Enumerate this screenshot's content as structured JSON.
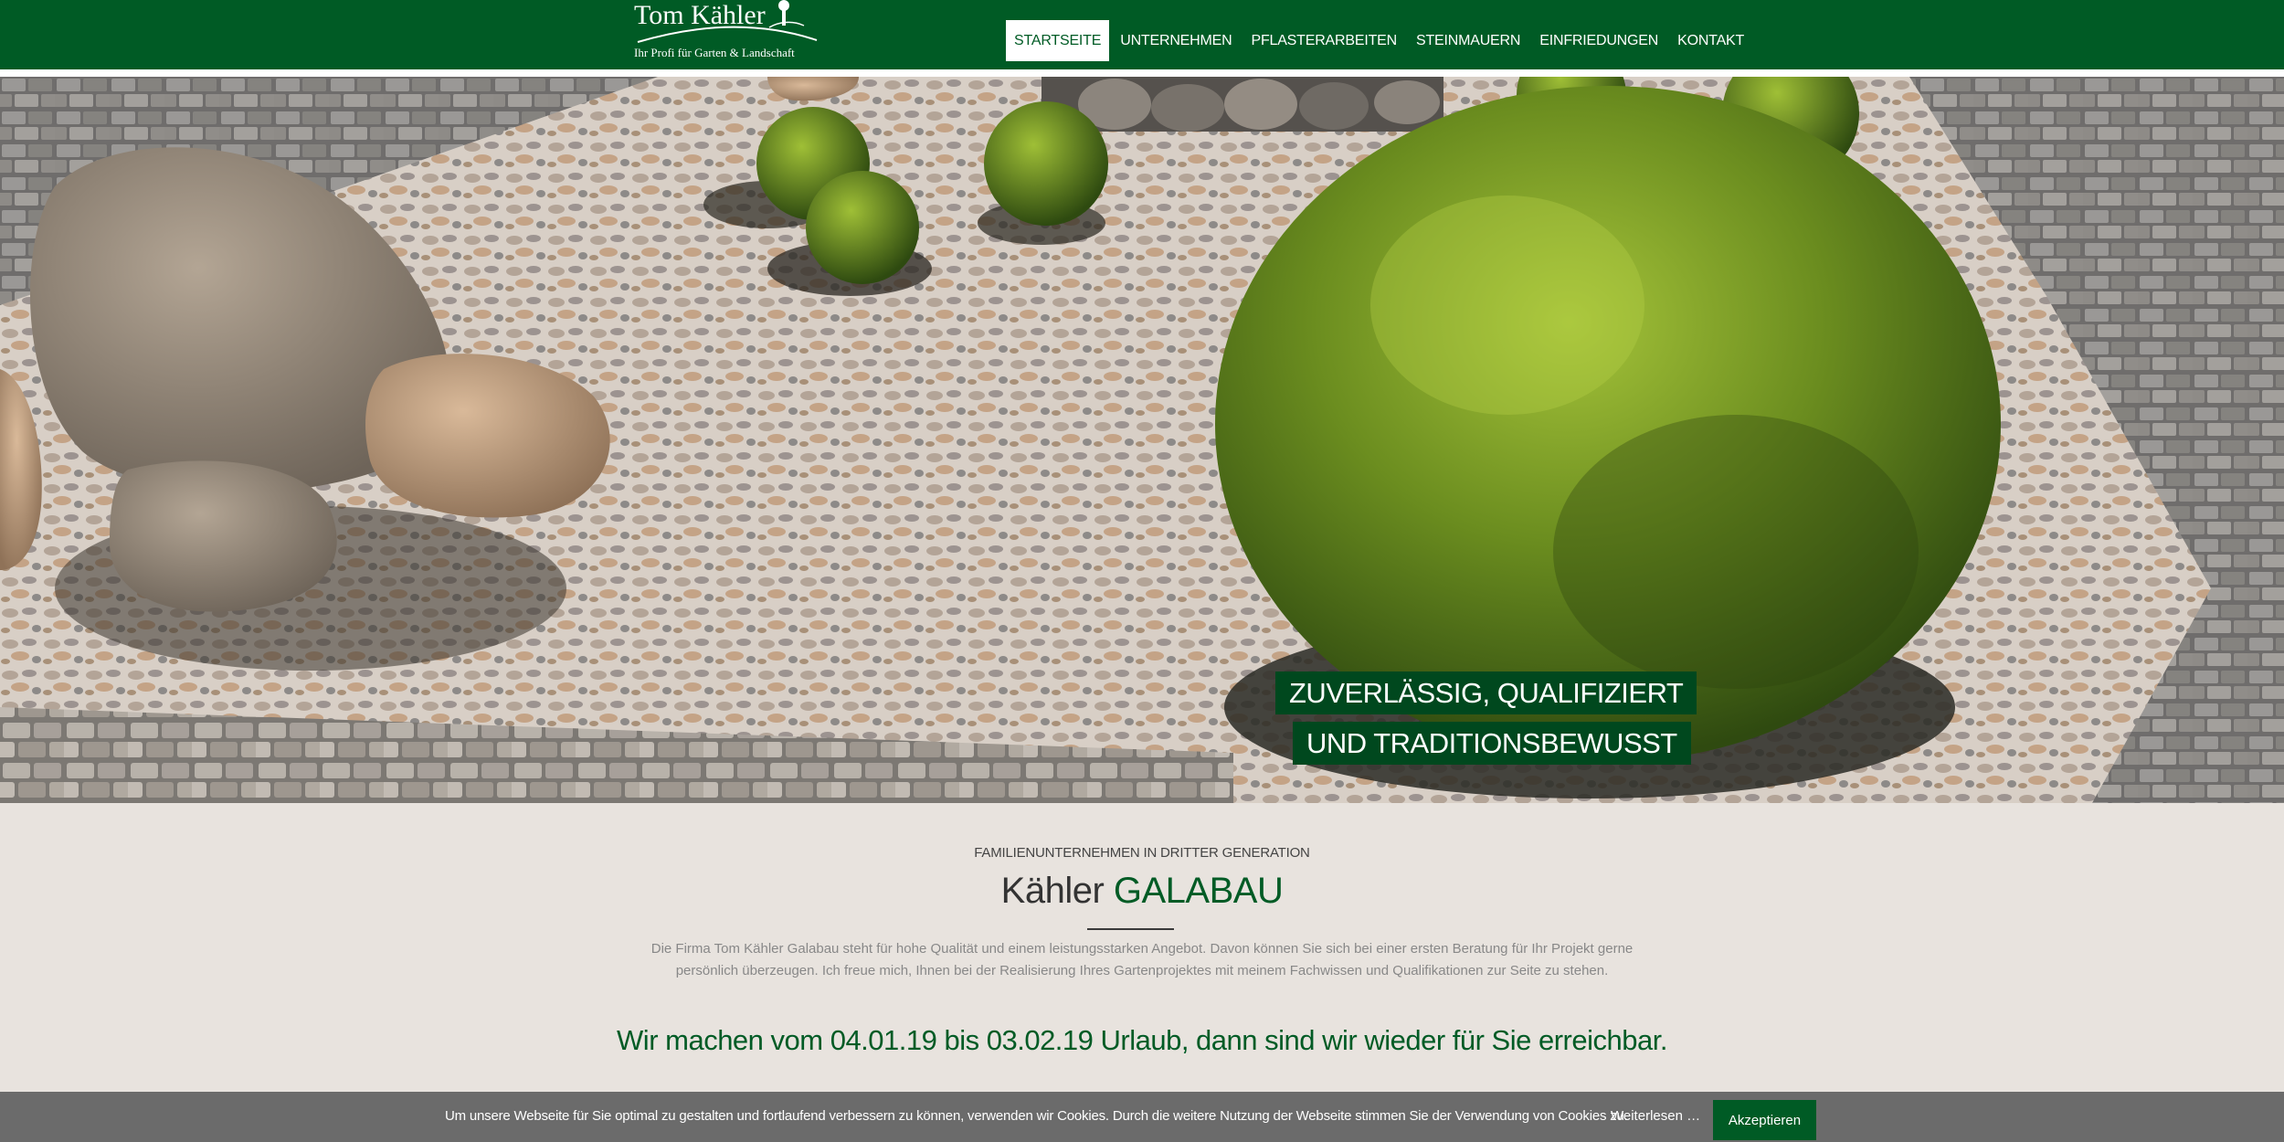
{
  "brand": {
    "name": "Tom Kähler",
    "tagline": "Ihr Profi für Garten & Landschaft"
  },
  "nav": {
    "items": [
      {
        "label": "STARTSEITE",
        "active": true
      },
      {
        "label": "UNTERNEHMEN",
        "active": false
      },
      {
        "label": "PFLASTERARBEITEN",
        "active": false
      },
      {
        "label": "STEINMAUERN",
        "active": false
      },
      {
        "label": "EINFRIEDUNGEN",
        "active": false
      },
      {
        "label": "KONTAKT",
        "active": false
      }
    ]
  },
  "hero": {
    "caption_line1": "ZUVERLÄSSIG, QUALIFIZIERT",
    "caption_line2": "UND TRADITIONSBEWUSST"
  },
  "intro": {
    "kicker": "FAMILIENUNTERNEHMEN IN DRITTER GENERATION",
    "title_plain": "Kähler ",
    "title_accent": "GALABAU",
    "text": "Die Firma Tom Kähler Galabau steht für hohe Qualität und einem leistungsstarken Angebot. Davon können Sie sich bei einer ersten Beratung für Ihr Projekt gerne persönlich überzeugen. Ich freue mich, Ihnen bei der Realisierung Ihres Gartenprojektes mit meinem Fachwissen und Qualifikationen zur Seite zu stehen.",
    "holiday_notice": "Wir machen vom 04.01.19 bis 03.02.19 Urlaub, dann sind wir wieder für Sie erreichbar."
  },
  "cookie": {
    "text": "Um unsere Webseite für Sie optimal zu gestalten und fortlaufend verbessern zu können, verwenden wir Cookies. Durch die weitere Nutzung der Webseite stimmen Sie der Verwendung von Cookies zu.",
    "more_label": "Weiterlesen …",
    "accept_label": "Akzeptieren"
  },
  "colors": {
    "brand_green": "#005b25",
    "caption_green": "#00481e",
    "page_background": "#e8e3de",
    "cookie_bar": "#6b6b6b"
  }
}
